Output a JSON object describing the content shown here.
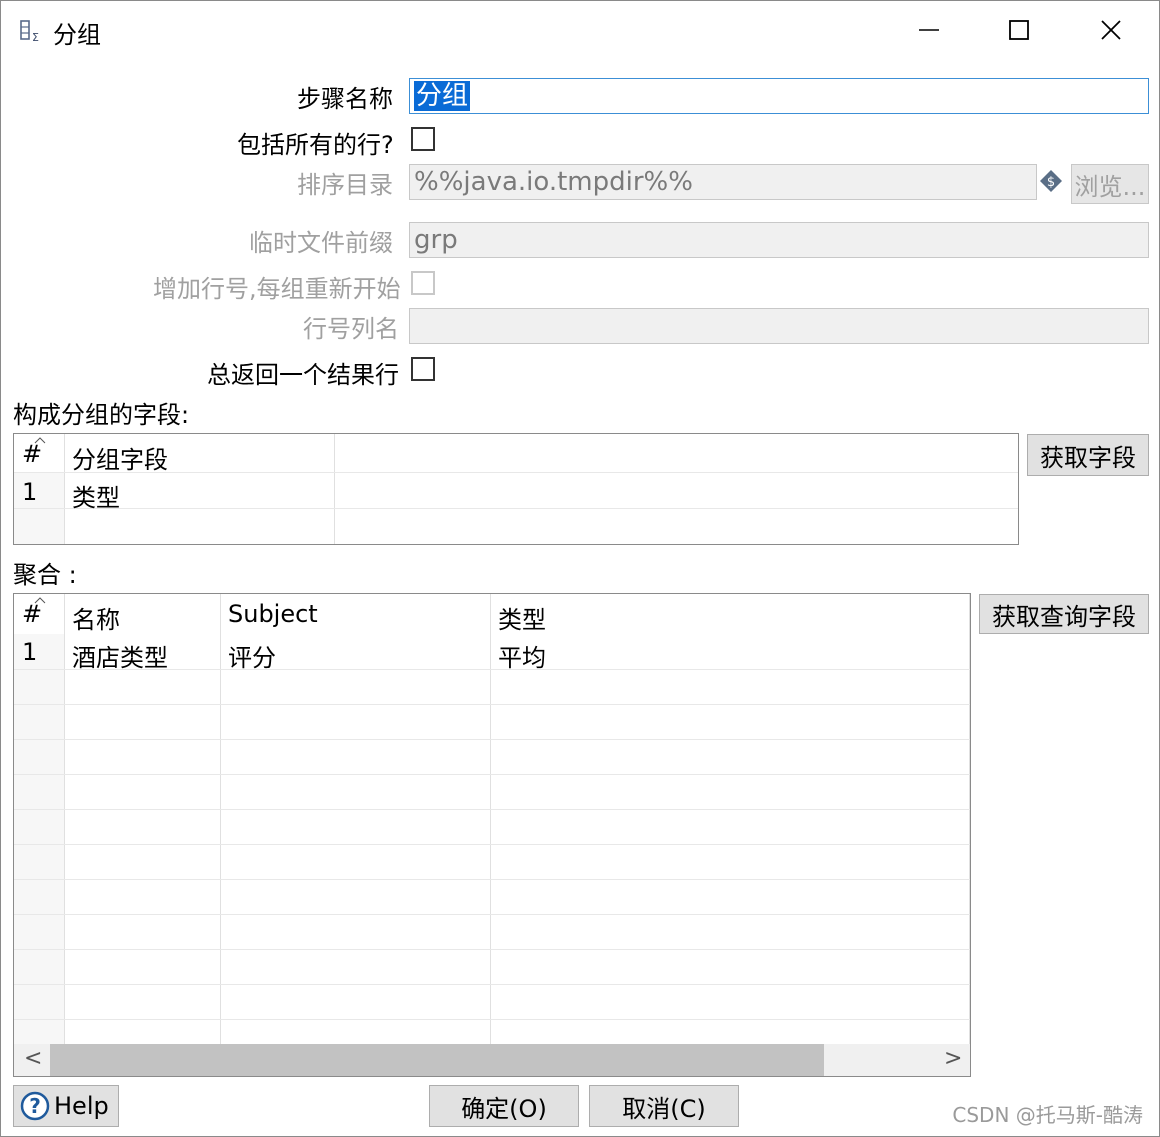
{
  "window": {
    "title": "分组",
    "icons": {
      "app": "group-by-icon",
      "minimize": "minimize-icon",
      "maximize": "maximize-icon",
      "close": "close-icon"
    }
  },
  "form": {
    "step_name_label": "步骤名称",
    "step_name_value": "分组",
    "include_all_rows_label": "包括所有的行?",
    "include_all_rows_checked": false,
    "sort_dir_label": "排序目录",
    "sort_dir_value": "%%java.io.tmpdir%%",
    "browse_label": "浏览...",
    "temp_prefix_label": "临时文件前缀",
    "temp_prefix_value": "grp",
    "add_line_number_label": "增加行号,每组重新开始",
    "add_line_number_checked": false,
    "line_number_field_label": "行号列名",
    "line_number_field_value": "",
    "always_return_row_label": "总返回一个结果行",
    "always_return_row_checked": false
  },
  "group_fields": {
    "title": "构成分组的字段:",
    "headers": [
      "#",
      "分组字段"
    ],
    "rows": [
      {
        "num": "1",
        "field": "类型"
      }
    ],
    "get_fields_label": "获取字段"
  },
  "aggregates": {
    "title": "聚合 :",
    "headers": [
      "#",
      "名称",
      "Subject",
      "类型"
    ],
    "rows": [
      {
        "num": "1",
        "name": "酒店类型",
        "subject": "评分",
        "type": "平均"
      }
    ],
    "get_lookup_fields_label": "获取查询字段",
    "scroll_left": "<",
    "scroll_right": ">"
  },
  "footer": {
    "help_label": "Help",
    "ok_label": "确定(O)",
    "cancel_label": "取消(C)"
  },
  "watermark": "CSDN @托马斯-酷涛"
}
